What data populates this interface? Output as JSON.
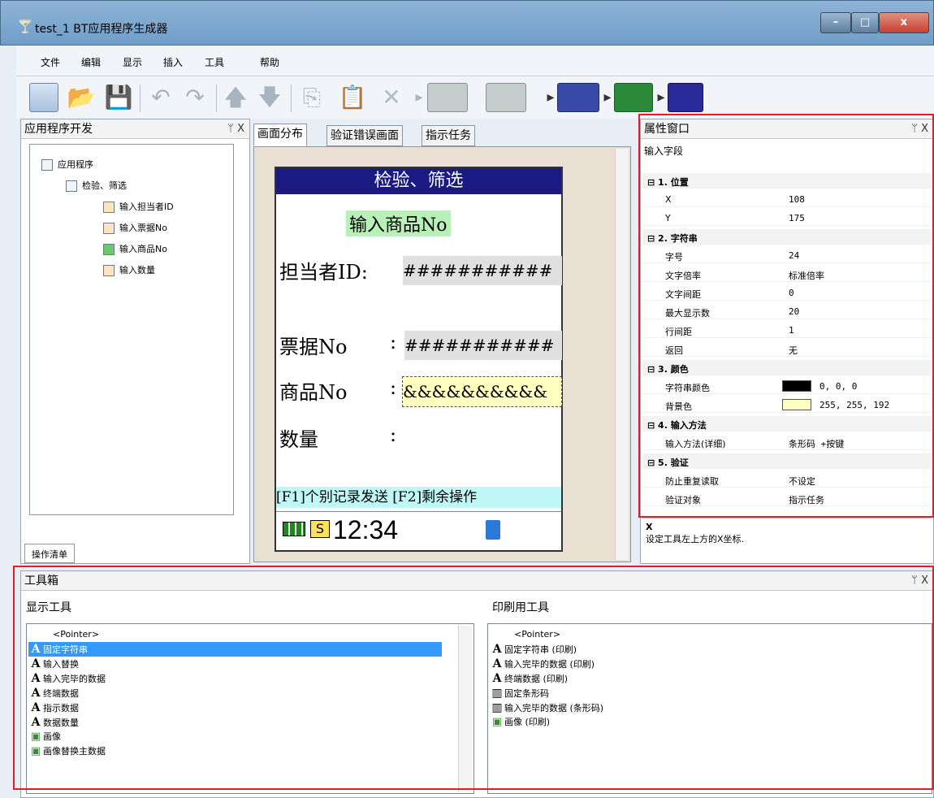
{
  "window": {
    "title": "test_1 BT应用程序生成器",
    "min": "–",
    "max": "□",
    "close": "x"
  },
  "menu": [
    "文件",
    "编辑",
    "显示",
    "插入",
    "工具",
    "帮助"
  ],
  "left_panel": {
    "title": "应用程序开发",
    "pin": "ᛘ X",
    "tree": {
      "root": "应用程序",
      "child": "检验、筛选",
      "items": [
        "输入担当者ID",
        "输入票据No",
        "输入商品No",
        "输入数量"
      ]
    },
    "bottom_tab": "操作清单"
  },
  "tabs": [
    "画面分布",
    "验证错误画面",
    "指示任务"
  ],
  "screen": {
    "title": "检验、筛选",
    "highlight": "输入商品No",
    "rows": [
      {
        "label": "担当者ID:",
        "value": "###########"
      },
      {
        "label": "票据No",
        "colon": ":",
        "value": "###########"
      },
      {
        "label": "商品No",
        "colon": ":",
        "value": "&&&&&&&&&&"
      },
      {
        "label": "数量",
        "colon": ":"
      }
    ],
    "footer": "[F1]个别记录发送 [F2]剩余操作",
    "status_s": "S",
    "time": "12:34"
  },
  "properties": {
    "title": "属性窗口",
    "pin": "ᛘ X",
    "field": "输入字段",
    "rows": [
      {
        "cat": true,
        "k": "⊟ 1. 位置"
      },
      {
        "k": "X",
        "v": "108"
      },
      {
        "k": "Y",
        "v": "175"
      },
      {
        "cat": true,
        "k": "⊟ 2. 字符串"
      },
      {
        "k": "字号",
        "v": "24"
      },
      {
        "k": "文字倍率",
        "v": "标准倍率"
      },
      {
        "k": "文字间距",
        "v": "0"
      },
      {
        "k": "最大显示数",
        "v": "20"
      },
      {
        "k": "行间距",
        "v": "1"
      },
      {
        "k": "返回",
        "v": "无"
      },
      {
        "cat": true,
        "k": "⊟ 3. 颜色"
      },
      {
        "k": "字符串颜色",
        "v": "0, 0, 0",
        "swatch": "#000000"
      },
      {
        "k": "背景色",
        "v": "255, 255, 192",
        "swatch": "#ffffc0"
      },
      {
        "cat": true,
        "k": "⊟ 4. 输入方法"
      },
      {
        "k": "输入方法(详细)",
        "v": "条形码 +按键"
      },
      {
        "cat": true,
        "k": "⊟ 5. 验证"
      },
      {
        "k": "防止重复读取",
        "v": "不设定"
      },
      {
        "k": "验证对象",
        "v": "指示任务"
      }
    ],
    "desc_title": "X",
    "desc": "设定工具左上方的X坐标."
  },
  "toolbox": {
    "title": "工具箱",
    "pin": "ᛘ X",
    "display_tools_title": "显示工具",
    "display_tools": [
      "<Pointer>",
      "固定字符串",
      "输入替换",
      "输入完毕的数据",
      "终端数据",
      "指示数据",
      "数据数量",
      "画像",
      "画像替换主数据"
    ],
    "print_tools_title": "印刷用工具",
    "print_tools": [
      "<Pointer>",
      "固定字符串 (印刷)",
      "输入完毕的数据 (印刷)",
      "终端数据 (印刷)",
      "固定条形码",
      "输入完毕的数据 (条形码)",
      "画像 (印刷)"
    ]
  }
}
